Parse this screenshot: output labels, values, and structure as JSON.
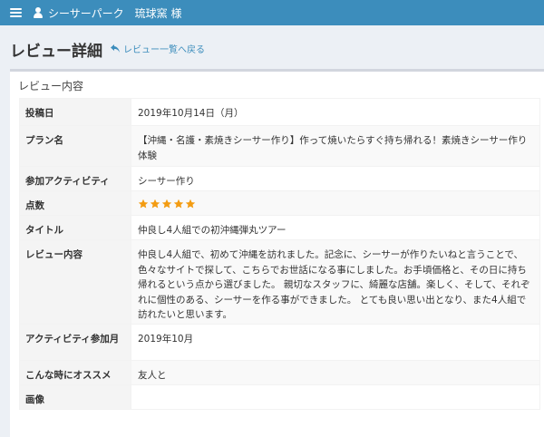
{
  "topbar": {
    "username": "シーサーパーク　琉球窯 様"
  },
  "header": {
    "title": "レビュー詳細",
    "back_link": "レビュー一覧へ戻る"
  },
  "box": {
    "title": "レビュー内容"
  },
  "rows": {
    "posted_date": {
      "label": "投稿日",
      "value": "2019年10月14日（月）"
    },
    "plan_name": {
      "label": "プラン名",
      "value": "【沖縄・名護・素焼きシーサー作り】作って焼いたらすぐ持ち帰れる！素焼きシーサー作り体験"
    },
    "activity": {
      "label": "参加アクティビティ",
      "value": "シーサー作り"
    },
    "score": {
      "label": "点数",
      "rating": 5,
      "max": 5
    },
    "review_title": {
      "label": "タイトル",
      "value": "仲良し4人組での初沖縄弾丸ツアー"
    },
    "review_body": {
      "label": "レビュー内容",
      "value": "仲良し4人組で、初めて沖縄を訪れました。記念に、シーサーが作りたいねと言うことで、色々なサイトで探して、こちらでお世話になる事にしました。お手頃価格と、その日に持ち帰れるという点から選びました。 親切なスタッフに、綺麗な店舗。楽しく、そして、それぞれに個性のある、シーサーを作る事ができました。 とても良い思い出となり、また4人組で訪れたいと思います。"
    },
    "activity_month": {
      "label": "アクティビティ参加月",
      "value": "2019年10月"
    },
    "recommend": {
      "label": "こんな時にオススメ",
      "value": "友人と"
    },
    "image": {
      "label": "画像",
      "value": ""
    }
  },
  "colors": {
    "topbar": "#3c8dbc",
    "link": "#3c8dbc",
    "star": "#f39c12",
    "page_bg": "#ecf0f5"
  },
  "icons": [
    "hamburger-icon",
    "user-icon",
    "reply-icon",
    "star-icon"
  ]
}
